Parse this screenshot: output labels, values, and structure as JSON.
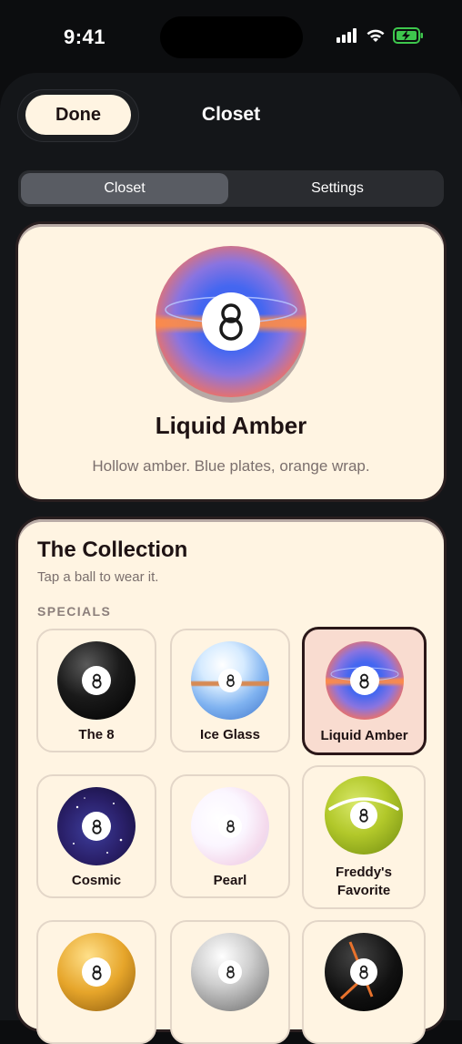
{
  "status": {
    "time": "9:41"
  },
  "header": {
    "done_label": "Done",
    "title": "Closet"
  },
  "segments": {
    "left": "Closet",
    "right": "Settings"
  },
  "hero": {
    "name": "Liquid Amber",
    "description": "Hollow amber. Blue plates, orange wrap."
  },
  "collection": {
    "title": "The Collection",
    "subtitle": "Tap a ball to wear it.",
    "section": "SPECIALS",
    "items": [
      {
        "label": "The 8",
        "style": "black",
        "selected": false
      },
      {
        "label": "Ice Glass",
        "style": "ice",
        "selected": false
      },
      {
        "label": "Liquid Amber",
        "style": "amber",
        "selected": true
      },
      {
        "label": "Cosmic",
        "style": "cosmic",
        "selected": false
      },
      {
        "label": "Pearl",
        "style": "pearl",
        "selected": false
      },
      {
        "label": "Freddy's Favorite",
        "style": "freddy",
        "selected": false
      },
      {
        "label": "",
        "style": "gold",
        "selected": false
      },
      {
        "label": "",
        "style": "silver",
        "selected": false
      },
      {
        "label": "",
        "style": "clock",
        "selected": false
      }
    ]
  },
  "colors": {
    "background": "#0c0d0f",
    "card": "#fff4e2",
    "accent": "#1e1213",
    "selected_tile": "#f9dcd0"
  }
}
